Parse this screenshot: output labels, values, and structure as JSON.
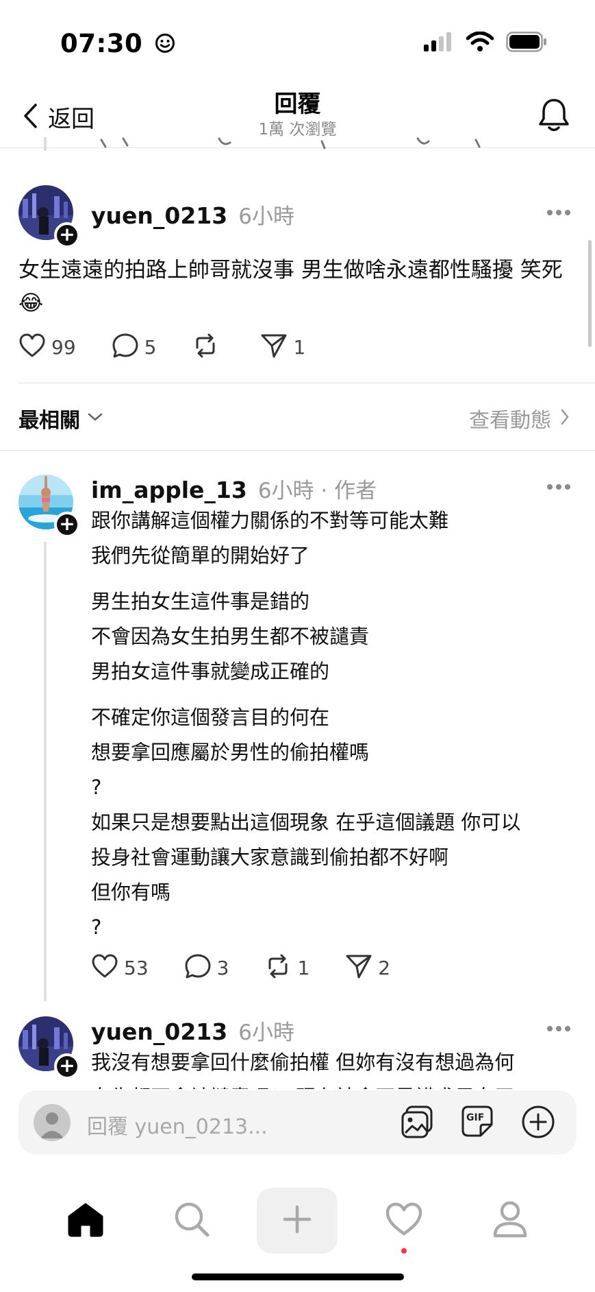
{
  "status_bar": {
    "time": "07:30",
    "time_emoji": "☺"
  },
  "header": {
    "back_label": "返回",
    "title": "回覆",
    "subtitle": "1萬 次瀏覽"
  },
  "main_post": {
    "username": "yuen_0213",
    "time": "6小時",
    "text": "女生遠遠的拍路上帥哥就沒事 男生做啥永遠都性騷擾 笑死😂",
    "likes": "99",
    "replies": "5",
    "reposts": "",
    "shares": "1"
  },
  "sort": {
    "label": "最相關",
    "view_activity": "查看動態"
  },
  "reply1": {
    "username": "im_apple_13",
    "meta": "6小時 · 作者",
    "paragraphs": [
      [
        "跟你講解這個權力關係的不對等可能太難",
        "我們先從簡單的開始好了"
      ],
      [
        "男生拍女生這件事是錯的",
        "不會因為女生拍男生都不被譴責",
        "男拍女這件事就變成正確的"
      ],
      [
        "不確定你這個發言目的何在",
        "想要拿回應屬於男性的偷拍權嗎",
        "?",
        "如果只是想要點出這個現象 在乎這個議題 你可以",
        "投身社會運動讓大家意識到偷拍都不好啊",
        "但你有嗎",
        "?"
      ]
    ],
    "likes": "53",
    "replies": "3",
    "reposts": "1",
    "shares": "2"
  },
  "reply2": {
    "username": "yuen_0213",
    "time": "6小時",
    "line1": "我沒有想要拿回什麼偷拍權 但妳有沒有想過為何",
    "line2": "女生都不會被譴責呢？ 現在社會不是講求男女平"
  },
  "composer": {
    "placeholder": "回覆 yuen_0213...",
    "gif_label": "GIF"
  },
  "colors": {
    "text": "#111111",
    "muted": "#9a9a9a",
    "divider": "#e2e2e2",
    "notification_dot": "#ff3040"
  }
}
